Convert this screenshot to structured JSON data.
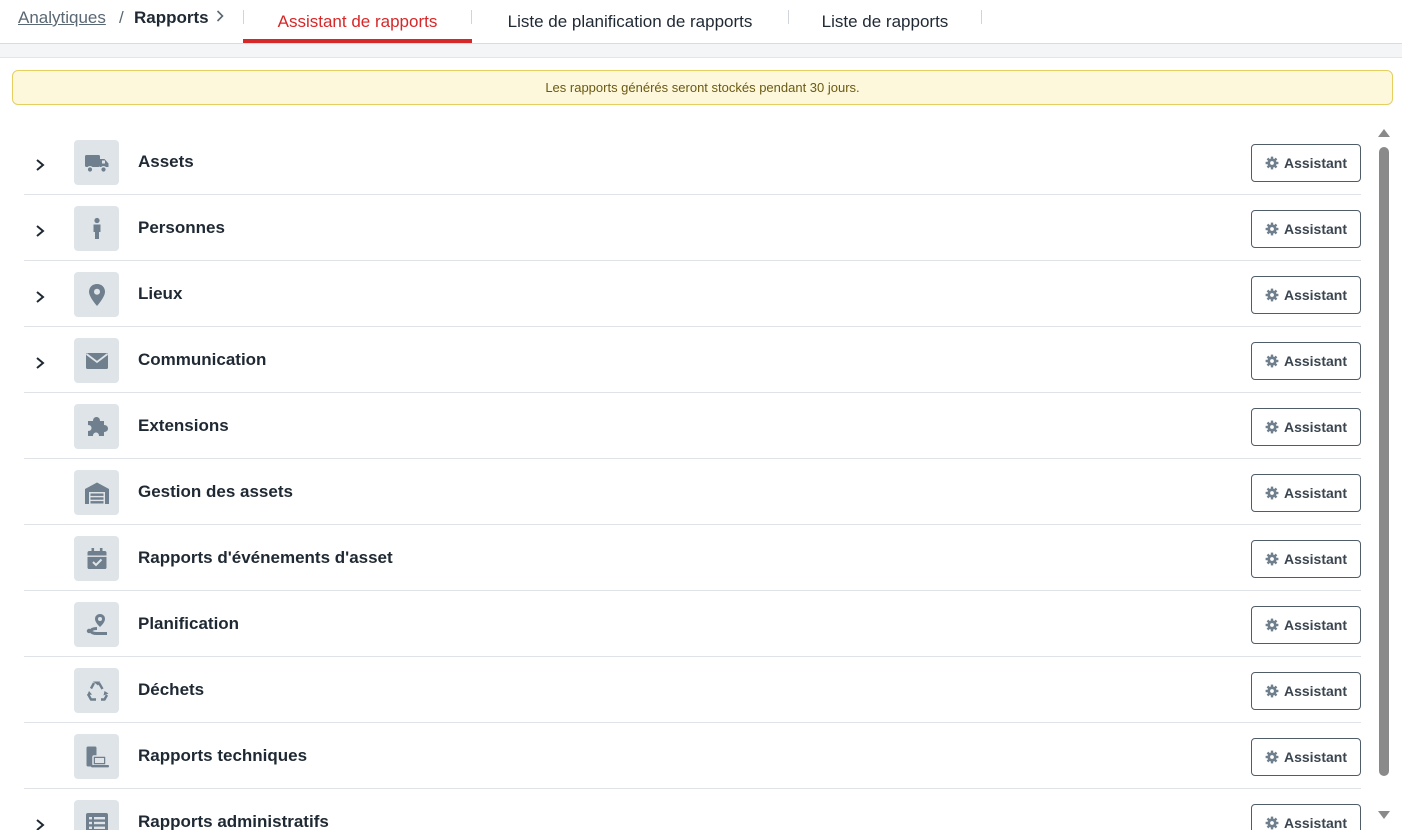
{
  "breadcrumb": {
    "parent": "Analytiques",
    "separator": "/",
    "current": "Rapports"
  },
  "tabs": [
    {
      "label": "Assistant de rapports",
      "active": true
    },
    {
      "label": "Liste de planification de rapports",
      "active": false
    },
    {
      "label": "Liste de rapports",
      "active": false
    }
  ],
  "notice": "Les rapports générés seront stockés pendant 30 jours.",
  "button_label": "Assistant",
  "colors": {
    "accent": "#d62828",
    "notice_bg": "#fdf8dc",
    "icon_bg": "#dfe4e9",
    "icon_fg": "#6f7f8d"
  },
  "rows": [
    {
      "label": "Assets",
      "icon": "truck-icon",
      "expandable": true
    },
    {
      "label": "Personnes",
      "icon": "person-icon",
      "expandable": true
    },
    {
      "label": "Lieux",
      "icon": "map-pin-icon",
      "expandable": true
    },
    {
      "label": "Communication",
      "icon": "envelope-icon",
      "expandable": true
    },
    {
      "label": "Extensions",
      "icon": "puzzle-icon",
      "expandable": false
    },
    {
      "label": "Gestion des assets",
      "icon": "warehouse-icon",
      "expandable": false
    },
    {
      "label": "Rapports d'événements d'asset",
      "icon": "calendar-check-icon",
      "expandable": false
    },
    {
      "label": "Planification",
      "icon": "route-icon",
      "expandable": false
    },
    {
      "label": "Déchets",
      "icon": "recycle-icon",
      "expandable": false
    },
    {
      "label": "Rapports techniques",
      "icon": "devices-icon",
      "expandable": false
    },
    {
      "label": "Rapports administratifs",
      "icon": "list-icon",
      "expandable": true
    }
  ]
}
